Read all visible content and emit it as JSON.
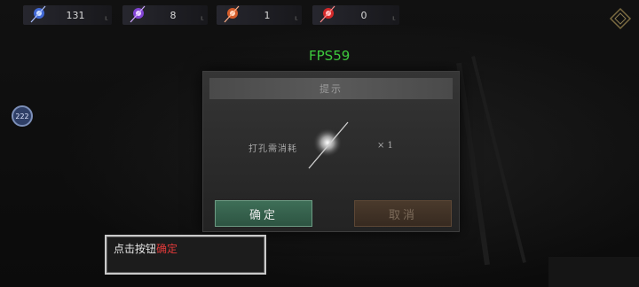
{
  "resources": [
    {
      "icon": "blue-gem-icon",
      "value": "131",
      "color": "#4a7bff"
    },
    {
      "icon": "purple-gem-icon",
      "value": "8",
      "color": "#9a4cff"
    },
    {
      "icon": "orange-gem-icon",
      "value": "1",
      "color": "#ff6a2a"
    },
    {
      "icon": "red-gem-icon",
      "value": "0",
      "color": "#ff2a2a"
    }
  ],
  "fps": "FPS59",
  "level_badge": "222",
  "dialog": {
    "title": "提示",
    "message": "打孔需消耗",
    "quantity": "× 1",
    "confirm_label": "确定",
    "cancel_label": "取消"
  },
  "tip": {
    "prefix": "点击按钮",
    "highlight": "确定"
  },
  "colors": {
    "confirm": "#3e6e57",
    "cancel": "#4a3a2c",
    "fps": "#3fcf3f",
    "tip_highlight": "#e23a3a"
  }
}
